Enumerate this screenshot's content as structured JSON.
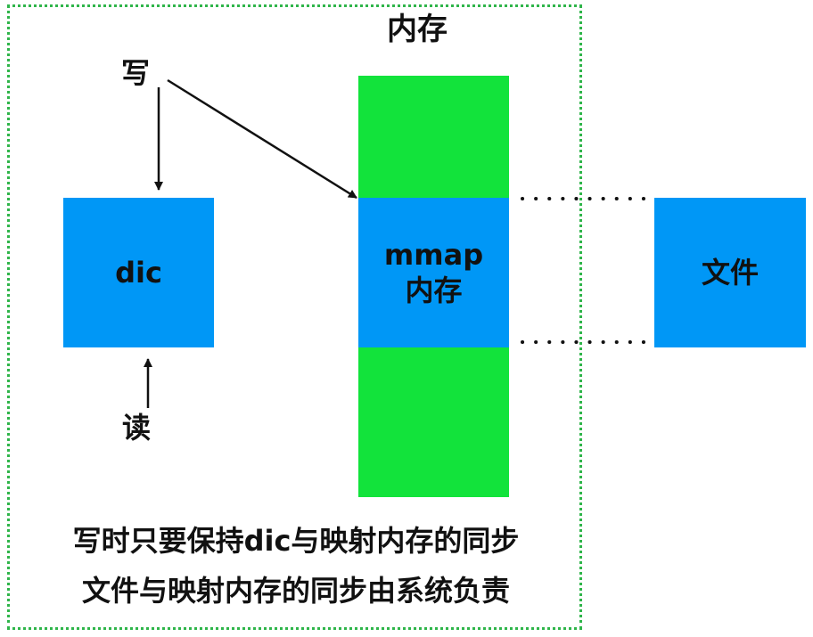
{
  "title": "内存",
  "labels": {
    "write": "写",
    "read": "读"
  },
  "boxes": {
    "dic": "dic",
    "mmap_line1": "mmap",
    "mmap_line2": "内存",
    "file": "文件"
  },
  "notes": {
    "line1": "写时只要保持dic与映射内存的同步",
    "line2": "文件与映射内存的同步由系统负责"
  },
  "colors": {
    "box_blue": "#0097f6",
    "memory_green": "#12e33b",
    "boundary_green": "#2fb54a",
    "text": "#111111"
  }
}
